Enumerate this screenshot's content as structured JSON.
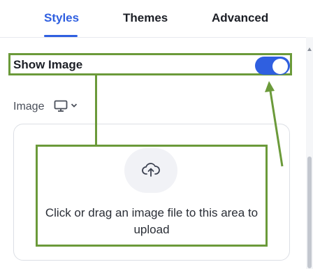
{
  "tabs": [
    {
      "label": "Styles",
      "active": true
    },
    {
      "label": "Themes",
      "active": false
    },
    {
      "label": "Advanced",
      "active": false
    }
  ],
  "show_image": {
    "label": "Show Image",
    "enabled": true
  },
  "image_section": {
    "label": "Image",
    "device_icon": "monitor-icon",
    "dropdown_icon": "chevron-down-icon"
  },
  "upload": {
    "icon": "cloud-upload-icon",
    "text": "Click or drag an image file to this area to upload"
  },
  "colors": {
    "accent": "#2f5fe0",
    "annotation": "#6b9a3a"
  }
}
